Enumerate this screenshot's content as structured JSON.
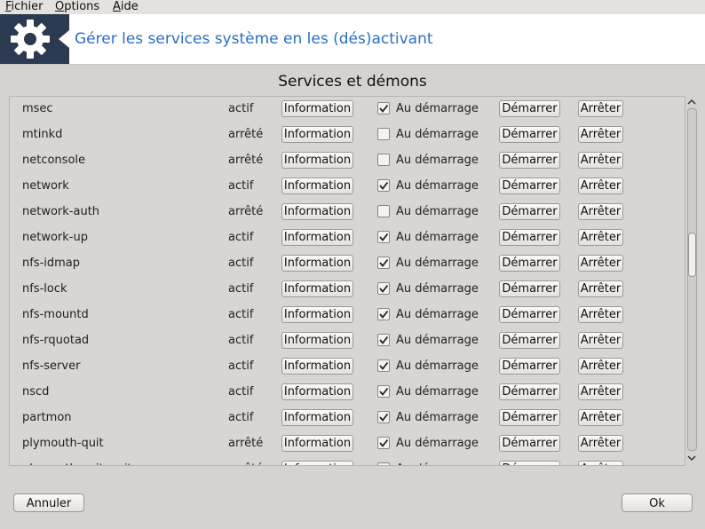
{
  "menubar": {
    "items": [
      {
        "accel": "F",
        "rest": "ichier"
      },
      {
        "accel": "O",
        "rest": "ptions"
      },
      {
        "accel": "A",
        "rest": "ide"
      }
    ]
  },
  "header": {
    "title": "Gérer les services système en les (dés)activant",
    "icon": "gear-icon"
  },
  "section_title": "Services et démons",
  "labels": {
    "info": "Information",
    "boot": "Au démarrage",
    "start": "Démarrer",
    "stop": "Arrêter"
  },
  "services": [
    {
      "name": "msec",
      "status": "actif",
      "boot": true
    },
    {
      "name": "mtinkd",
      "status": "arrêté",
      "boot": false
    },
    {
      "name": "netconsole",
      "status": "arrêté",
      "boot": false
    },
    {
      "name": "network",
      "status": "actif",
      "boot": true
    },
    {
      "name": "network-auth",
      "status": "arrêté",
      "boot": false
    },
    {
      "name": "network-up",
      "status": "actif",
      "boot": true
    },
    {
      "name": "nfs-idmap",
      "status": "actif",
      "boot": true
    },
    {
      "name": "nfs-lock",
      "status": "actif",
      "boot": true
    },
    {
      "name": "nfs-mountd",
      "status": "actif",
      "boot": true
    },
    {
      "name": "nfs-rquotad",
      "status": "actif",
      "boot": true
    },
    {
      "name": "nfs-server",
      "status": "actif",
      "boot": true
    },
    {
      "name": "nscd",
      "status": "actif",
      "boot": true
    },
    {
      "name": "partmon",
      "status": "actif",
      "boot": true
    },
    {
      "name": "plymouth-quit",
      "status": "arrêté",
      "boot": true
    },
    {
      "name": "plymouth-quit-wait",
      "status": "arrêté",
      "boot": true
    }
  ],
  "footer": {
    "cancel": "Annuler",
    "ok": "Ok"
  },
  "colors": {
    "title_blue": "#2a6fc4",
    "header_dark": "#2b3a50"
  }
}
